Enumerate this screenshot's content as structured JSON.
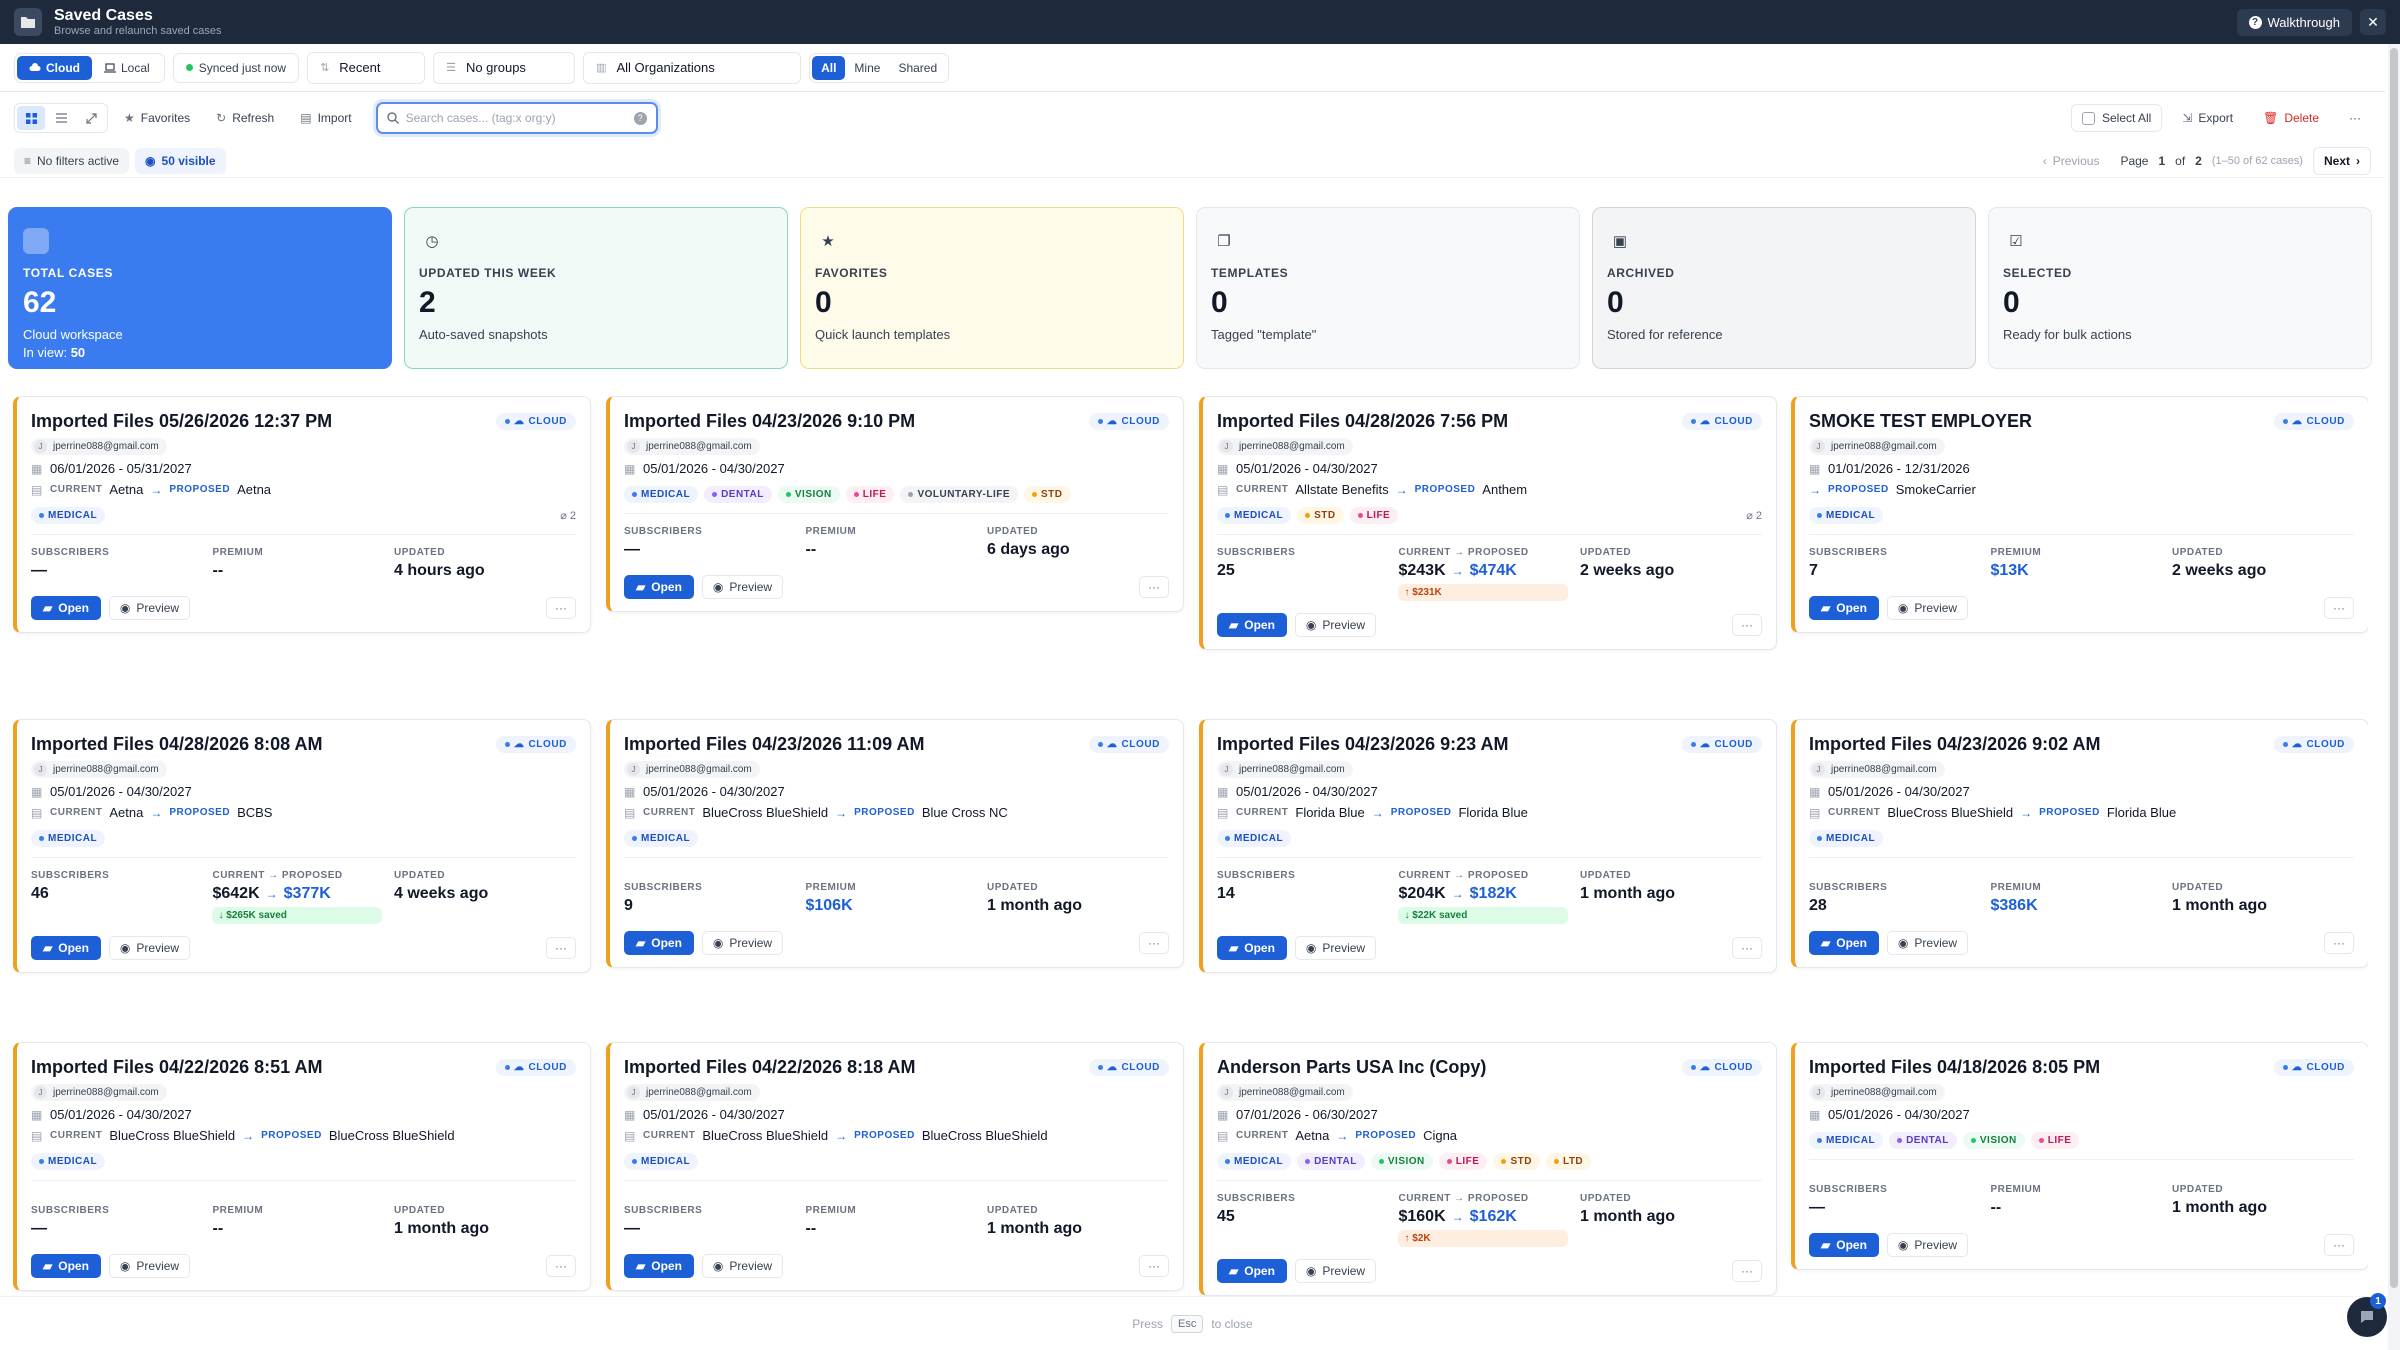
{
  "window": {
    "title": "Saved Cases",
    "subtitle": "Browse and relaunch saved cases",
    "walkthrough_label": "Walkthrough",
    "close_symbol": "✕"
  },
  "source": {
    "cloud_label": "Cloud",
    "local_label": "Local",
    "sync_status": "Synced just now"
  },
  "filters": {
    "sort": "Recent",
    "grouping": "No groups",
    "organization": "All Organizations",
    "scope": [
      "All",
      "Mine",
      "Shared"
    ]
  },
  "toolbar": {
    "favorites_label": "Favorites",
    "refresh_label": "Refresh",
    "import_label": "Import",
    "search_placeholder": "Search cases... (tag:x org:y)",
    "select_all_label": "Select All",
    "export_label": "Export",
    "delete_label": "Delete",
    "more_symbol": "···"
  },
  "status": {
    "filters_label": "No filters active",
    "visible_label": "50 visible"
  },
  "pagination": {
    "previous_label": "Previous",
    "page_prefix": "Page",
    "current_page": "1",
    "of_label": "of",
    "total_pages": "2",
    "range_text": "(1–50 of 62 cases)",
    "next_label": "Next"
  },
  "stats": [
    {
      "label": "TOTAL CASES",
      "value": "62",
      "sub": "Cloud workspace",
      "sub2_prefix": "In view:",
      "sub2_value": "50"
    },
    {
      "label": "UPDATED THIS WEEK",
      "value": "2",
      "sub": "Auto-saved snapshots"
    },
    {
      "label": "FAVORITES",
      "value": "0",
      "sub": "Quick launch templates"
    },
    {
      "label": "TEMPLATES",
      "value": "0",
      "sub": "Tagged \"template\""
    },
    {
      "label": "ARCHIVED",
      "value": "0",
      "sub": "Stored for reference"
    },
    {
      "label": "SELECTED",
      "value": "0",
      "sub": "Ready for bulk actions"
    }
  ],
  "card_labels": {
    "cloud": "CLOUD",
    "current": "CURRENT",
    "proposed": "PROPOSED",
    "subscribers": "SUBSCRIBERS",
    "premium": "PREMIUM",
    "current_proposed": "CURRENT → PROPOSED",
    "updated": "UPDATED",
    "open": "Open",
    "preview": "Preview",
    "more": "···"
  },
  "footer": {
    "press": "Press",
    "key": "Esc",
    "suffix": "to close",
    "fab_badge": "1"
  },
  "colors": {
    "accent": "#1d5fd6",
    "titlebar": "#1e2a3b",
    "card_border": "#f0a020",
    "total_card": "#3b7bf0"
  }
}
